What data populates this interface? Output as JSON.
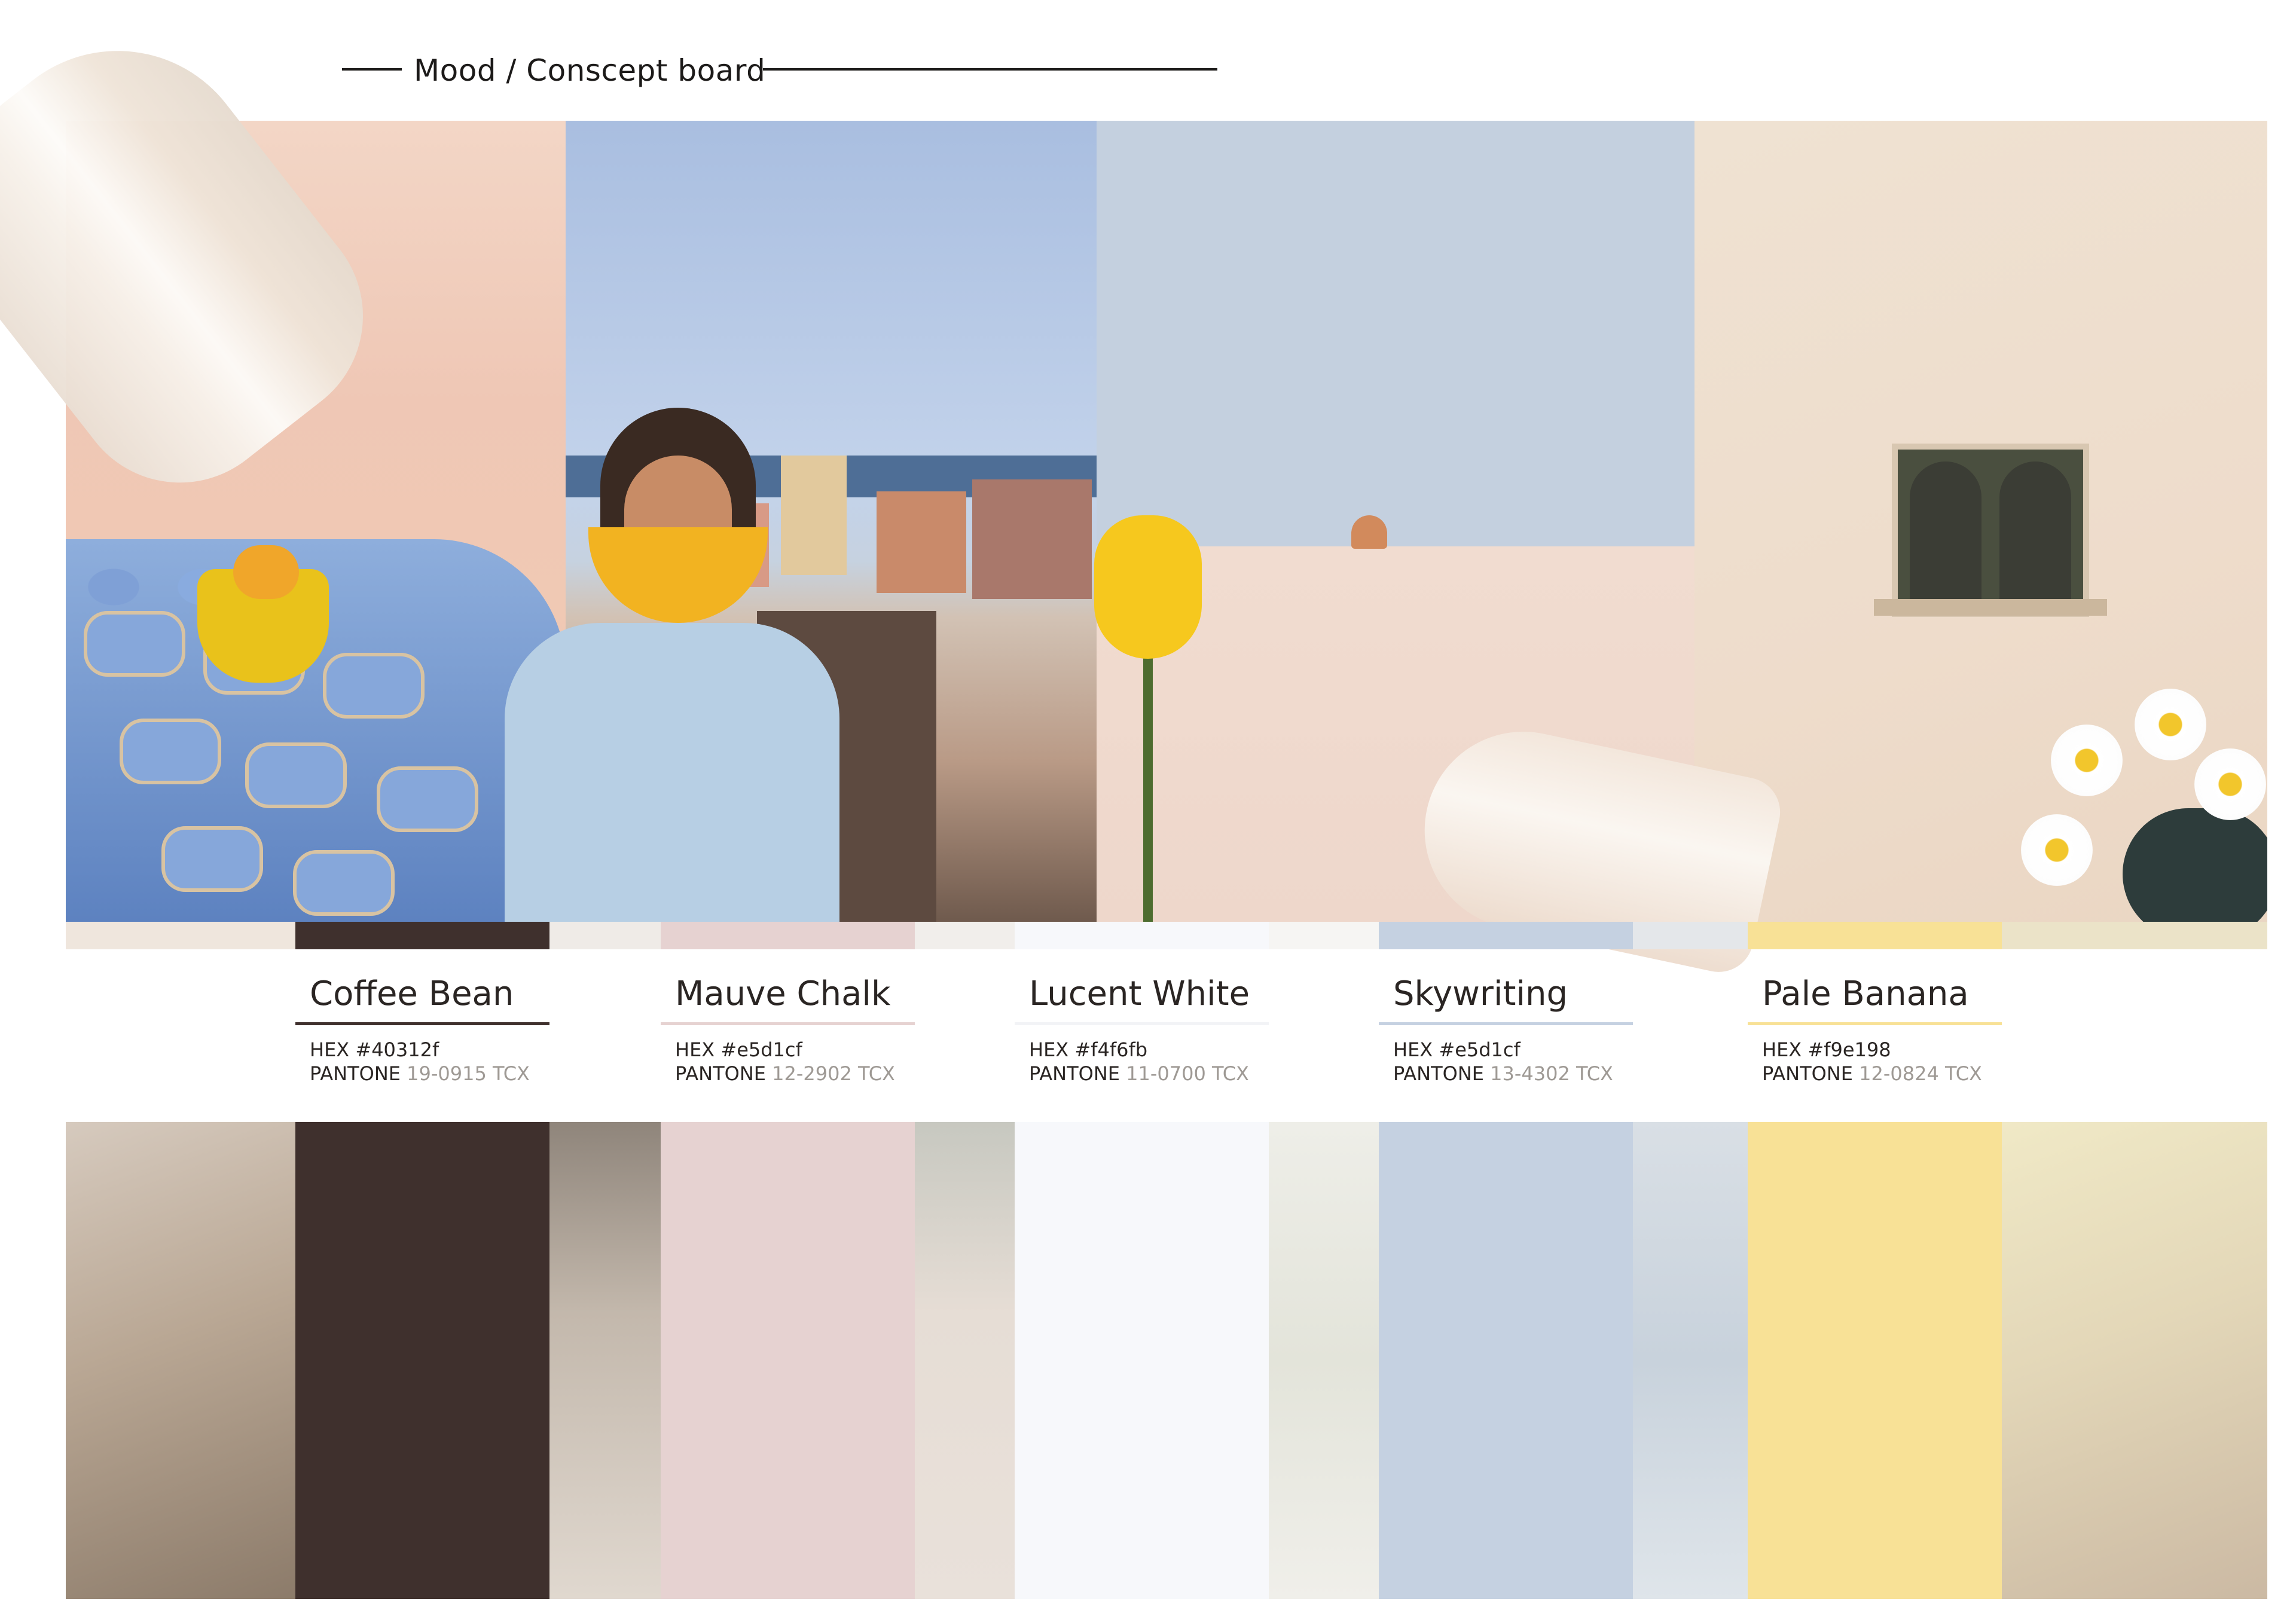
{
  "header": {
    "title": "Mood / Conscept board"
  },
  "palette": [
    {
      "name": "Coffee Bean",
      "hex_label": "HEX #40312f",
      "pantone_label": "PANTONE",
      "pantone_code": "19-0915 TCX",
      "swatch_color": "#3f302d",
      "underline_color": "#3f302d"
    },
    {
      "name": "Mauve Chalk",
      "hex_label": "HEX #e5d1cf",
      "pantone_label": "PANTONE",
      "pantone_code": "12-2902 TCX",
      "swatch_color": "#e6d2d1",
      "underline_color": "#e6d2d1"
    },
    {
      "name": "Lucent White",
      "hex_label": "HEX #f4f6fb",
      "pantone_label": "PANTONE",
      "pantone_code": "11-0700 TCX",
      "swatch_color": "#f7f8fb",
      "underline_color": "#f2f3f6"
    },
    {
      "name": "Skywriting",
      "hex_label": "HEX #e5d1cf",
      "pantone_label": "PANTONE",
      "pantone_code": "13-4302 TCX",
      "swatch_color": "#c5d1e1",
      "underline_color": "#c5d1e1"
    },
    {
      "name": "Pale Banana",
      "hex_label": "HEX #f9e198",
      "pantone_label": "PANTONE",
      "pantone_code": "12-0824 TCX",
      "swatch_color": "#f8e196",
      "underline_color": "#f8e196"
    }
  ]
}
